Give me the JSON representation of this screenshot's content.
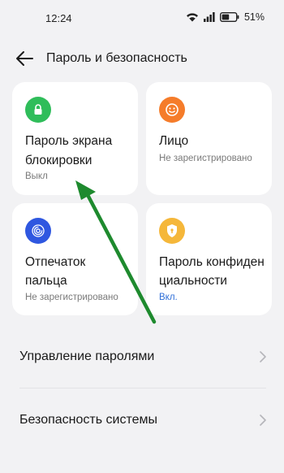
{
  "status_bar": {
    "time": "12:24",
    "battery_percent": "51%",
    "battery_level": 0.51
  },
  "header": {
    "title": "Пароль и безопасность",
    "back_icon": "arrow-left-icon"
  },
  "cards": [
    {
      "title_line1": "Пароль экрана",
      "title_line2": "блокировки",
      "status": "Выкл",
      "icon": "lock-icon",
      "icon_color": "#2fbd5a"
    },
    {
      "title_line1": "Лицо",
      "status": "Не зарегистрировано",
      "icon": "face-icon",
      "icon_color": "#f57c2a"
    },
    {
      "title_line1": "Отпечаток",
      "title_line2": "пальца",
      "status": "Не зарегистрировано",
      "icon": "fingerprint-icon",
      "icon_color": "#2f57e0"
    },
    {
      "title_line1": "Пароль конфиден",
      "title_line2": "циальности",
      "status": "Вкл.",
      "icon": "privacy-shield-icon",
      "icon_color": "#f5b73a"
    }
  ],
  "list": [
    {
      "label": "Управление паролями"
    },
    {
      "label": "Безопасность системы"
    }
  ],
  "colors": {
    "background": "#f2f2f4",
    "card": "#ffffff",
    "accent": "#2f6fd8",
    "annotation_arrow": "#1e8a2e"
  }
}
